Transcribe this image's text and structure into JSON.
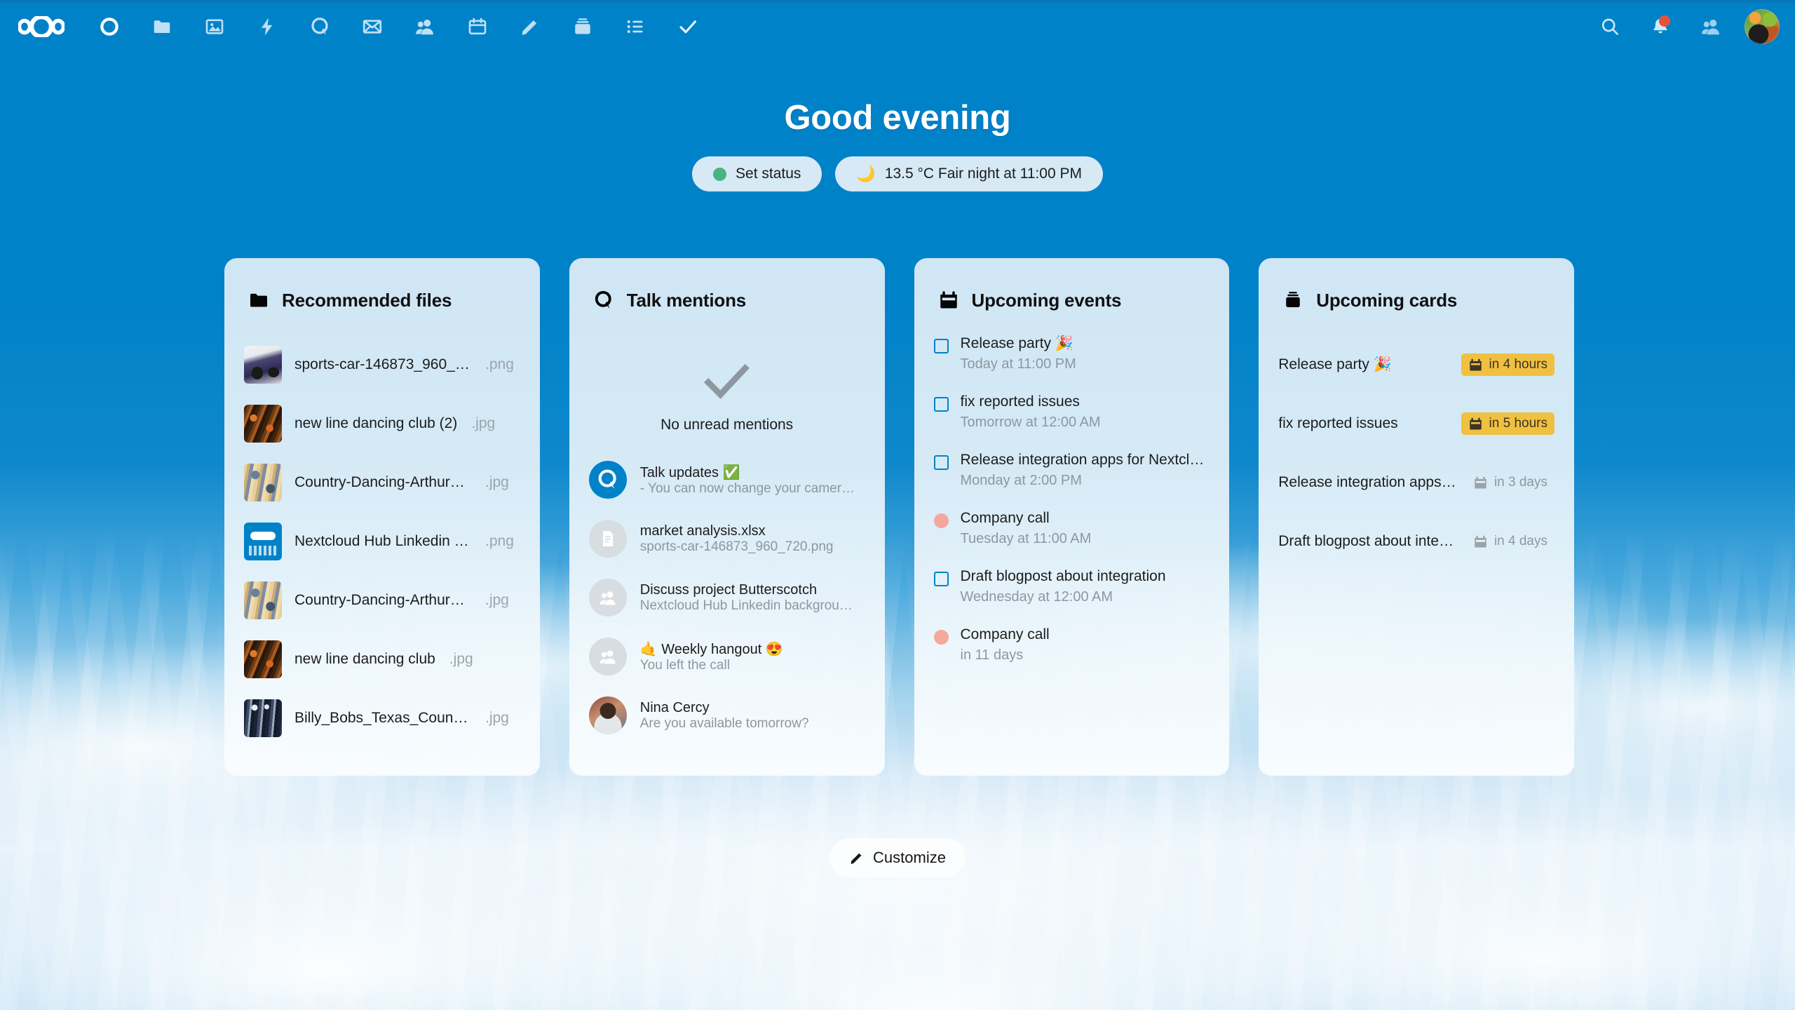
{
  "theme": {
    "brand_blue": "#0082c9",
    "panel_bg": "#d6e9f5",
    "urgent_badge": "#f0c040",
    "event_dot": "#f4a79b",
    "status_online": "#49b382",
    "notification_badge": "#e8503a"
  },
  "header": {
    "logo": "nextcloud-logo",
    "nav_items": [
      {
        "name": "dashboard",
        "icon": "circle-icon"
      },
      {
        "name": "files",
        "icon": "folder-icon"
      },
      {
        "name": "photos",
        "icon": "photos-icon"
      },
      {
        "name": "activity",
        "icon": "lightning-icon"
      },
      {
        "name": "talk",
        "icon": "talk-icon"
      },
      {
        "name": "mail",
        "icon": "envelope-icon"
      },
      {
        "name": "contacts",
        "icon": "contacts-icon"
      },
      {
        "name": "calendar",
        "icon": "calendar-icon"
      },
      {
        "name": "notes",
        "icon": "pencil-icon"
      },
      {
        "name": "deck",
        "icon": "deck-icon"
      },
      {
        "name": "tasks",
        "icon": "list-icon"
      },
      {
        "name": "checkmark",
        "icon": "check-icon"
      }
    ],
    "right_items": [
      {
        "name": "search",
        "icon": "search-icon"
      },
      {
        "name": "notifications",
        "icon": "bell-icon",
        "has_badge": true
      },
      {
        "name": "contacts-menu",
        "icon": "contacts-icon"
      }
    ],
    "avatar": "user-avatar"
  },
  "greeting": {
    "title": "Good evening",
    "status_label": "Set status",
    "weather_label": "13.5 °C Fair night at 11:00 PM",
    "weather_icon": "🌙"
  },
  "panels": {
    "recommended_files": {
      "title": "Recommended files",
      "icon": "folder-icon",
      "items": [
        {
          "name": "sports-car-146873_960_7…",
          "ext": ".png",
          "thumb": "car"
        },
        {
          "name": "new line dancing club (2)",
          "ext": ".jpg",
          "thumb": "dance-dark"
        },
        {
          "name": "Country-Dancing-Arthur_…",
          "ext": ".jpg",
          "thumb": "dance-light"
        },
        {
          "name": "Nextcloud Hub Linkedin b…",
          "ext": ".png",
          "thumb": "nextcloud"
        },
        {
          "name": "Country-Dancing-Arthur_…",
          "ext": ".jpg",
          "thumb": "dance-light"
        },
        {
          "name": "new line dancing club",
          "ext": ".jpg",
          "thumb": "dance-dark"
        },
        {
          "name": "Billy_Bobs_Texas_Countr…",
          "ext": ".jpg",
          "thumb": "stage"
        }
      ]
    },
    "talk_mentions": {
      "title": "Talk mentions",
      "icon": "talk-icon",
      "empty_state": "No unread mentions",
      "empty_icon": "check-icon",
      "items": [
        {
          "title": "Talk updates ✅",
          "subtitle": "- You can now change your camer…",
          "avatar": "talk"
        },
        {
          "title": "market analysis.xlsx",
          "subtitle": "sports-car-146873_960_720.png",
          "avatar": "file"
        },
        {
          "title": "Discuss project Butterscotch",
          "subtitle": "Nextcloud Hub Linkedin backgrou…",
          "avatar": "group"
        },
        {
          "title": "🤙 Weekly hangout 😍",
          "subtitle": "You left the call",
          "avatar": "group"
        },
        {
          "title": "Nina Cercy",
          "subtitle": "Are you available tomorrow?",
          "avatar": "photo"
        }
      ]
    },
    "upcoming_events": {
      "title": "Upcoming events",
      "icon": "calendar-icon",
      "items": [
        {
          "title": "Release party 🎉",
          "when": "Today at 11:00 PM",
          "marker": "checkbox"
        },
        {
          "title": "fix reported issues",
          "when": "Tomorrow at 12:00 AM",
          "marker": "checkbox"
        },
        {
          "title": "Release integration apps for Nextclou…",
          "when": "Monday at 2:00 PM",
          "marker": "checkbox"
        },
        {
          "title": "Company call",
          "when": "Tuesday at 11:00 AM",
          "marker": "dot"
        },
        {
          "title": "Draft blogpost about integration",
          "when": "Wednesday at 12:00 AM",
          "marker": "checkbox"
        },
        {
          "title": "Company call",
          "when": "in 11 days",
          "marker": "dot"
        }
      ]
    },
    "upcoming_cards": {
      "title": "Upcoming cards",
      "icon": "deck-icon",
      "items": [
        {
          "title": "Release party 🎉",
          "due": "in 4 hours",
          "urgent": true
        },
        {
          "title": "fix reported issues",
          "due": "in 5 hours",
          "urgent": true
        },
        {
          "title": "Release integration apps for…",
          "due": "in 3 days",
          "urgent": false
        },
        {
          "title": "Draft blogpost about integra…",
          "due": "in 4 days",
          "urgent": false
        }
      ]
    }
  },
  "footer": {
    "customize_label": "Customize",
    "customize_icon": "pencil-icon"
  }
}
